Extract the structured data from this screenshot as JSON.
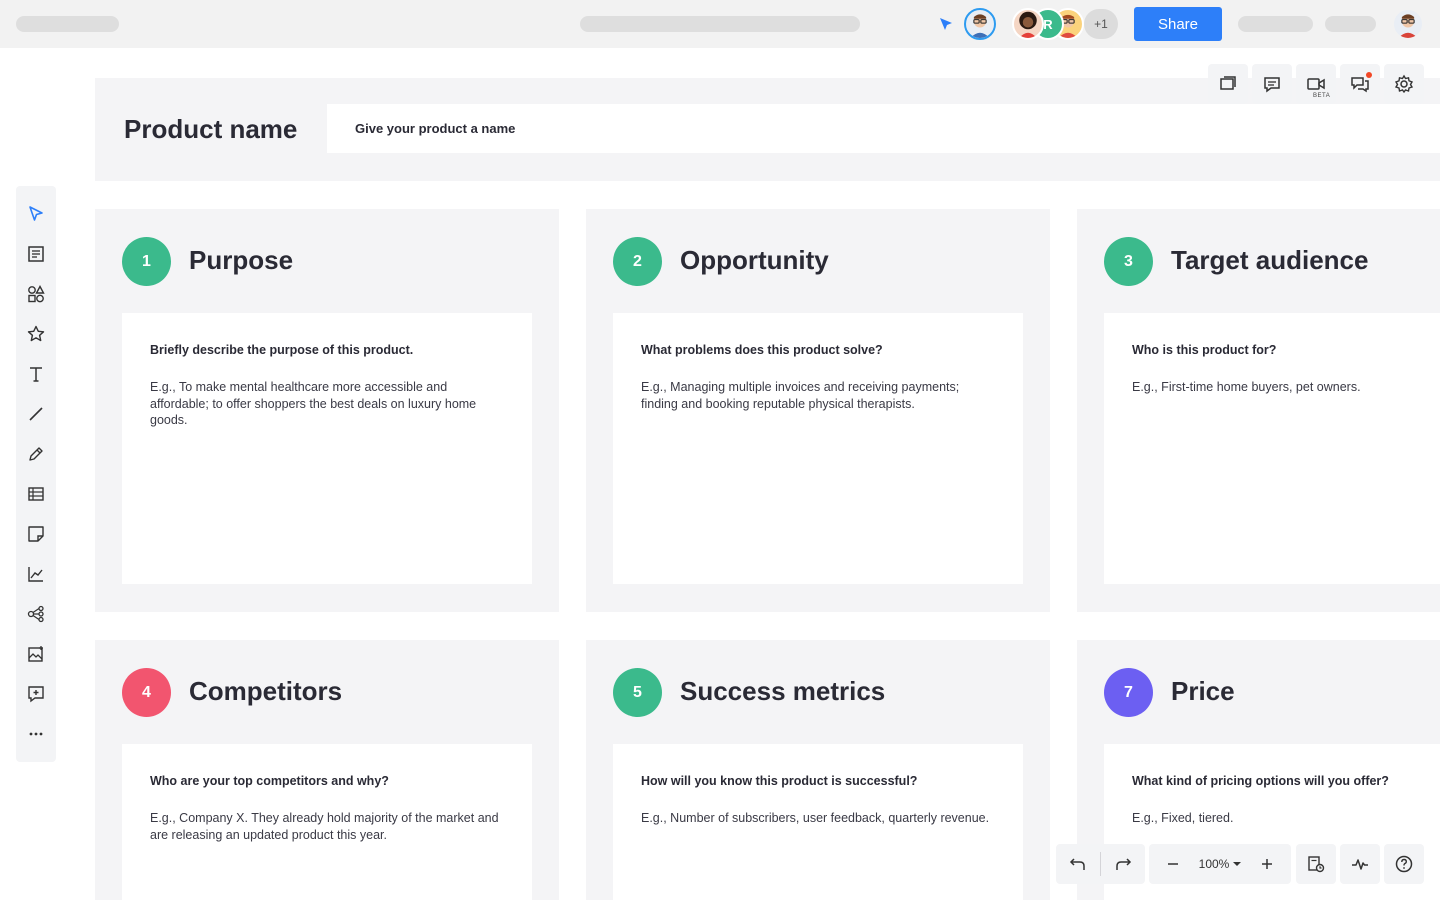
{
  "topbar": {
    "share_label": "Share",
    "collaborators_extra": "+1",
    "collaborator_r_initial": "R"
  },
  "board": {
    "product_title": "Product name",
    "product_placeholder": "Give your product a name"
  },
  "cards": [
    {
      "number": "1",
      "title": "Purpose",
      "question": "Briefly describe the purpose of this product.",
      "example": "E.g., To make mental healthcare more accessible and affordable; to offer shoppers the best deals on luxury home goods.",
      "color": "#3bba8c"
    },
    {
      "number": "2",
      "title": "Opportunity",
      "question": "What problems does this product solve?",
      "example": "E.g., Managing multiple invoices and receiving payments; finding and booking reputable physical therapists.",
      "color": "#3bba8c"
    },
    {
      "number": "3",
      "title": "Target audience",
      "question": "Who is this product for?",
      "example": "E.g., First-time home buyers, pet owners.",
      "color": "#3bba8c"
    },
    {
      "number": "4",
      "title": "Competitors",
      "question": "Who are your top competitors and why?",
      "example": "E.g., Company X. They already hold majority of the market and are releasing an updated product this year.",
      "color": "#f2556f"
    },
    {
      "number": "5",
      "title": "Success metrics",
      "question": "How will you know this product is successful?",
      "example": "E.g., Number of subscribers, user feedback, quarterly revenue.",
      "color": "#3bba8c"
    },
    {
      "number": "7",
      "title": "Price",
      "question": "What kind of pricing options will you offer?",
      "example": "E.g., Fixed, tiered.",
      "color": "#6c5ff2"
    }
  ],
  "canvas_tools": {
    "beta_label": "BETA"
  },
  "zoom": {
    "level": "100%"
  },
  "colors": {
    "accent": "#2d7ff9",
    "panel": "#f4f4f6"
  }
}
